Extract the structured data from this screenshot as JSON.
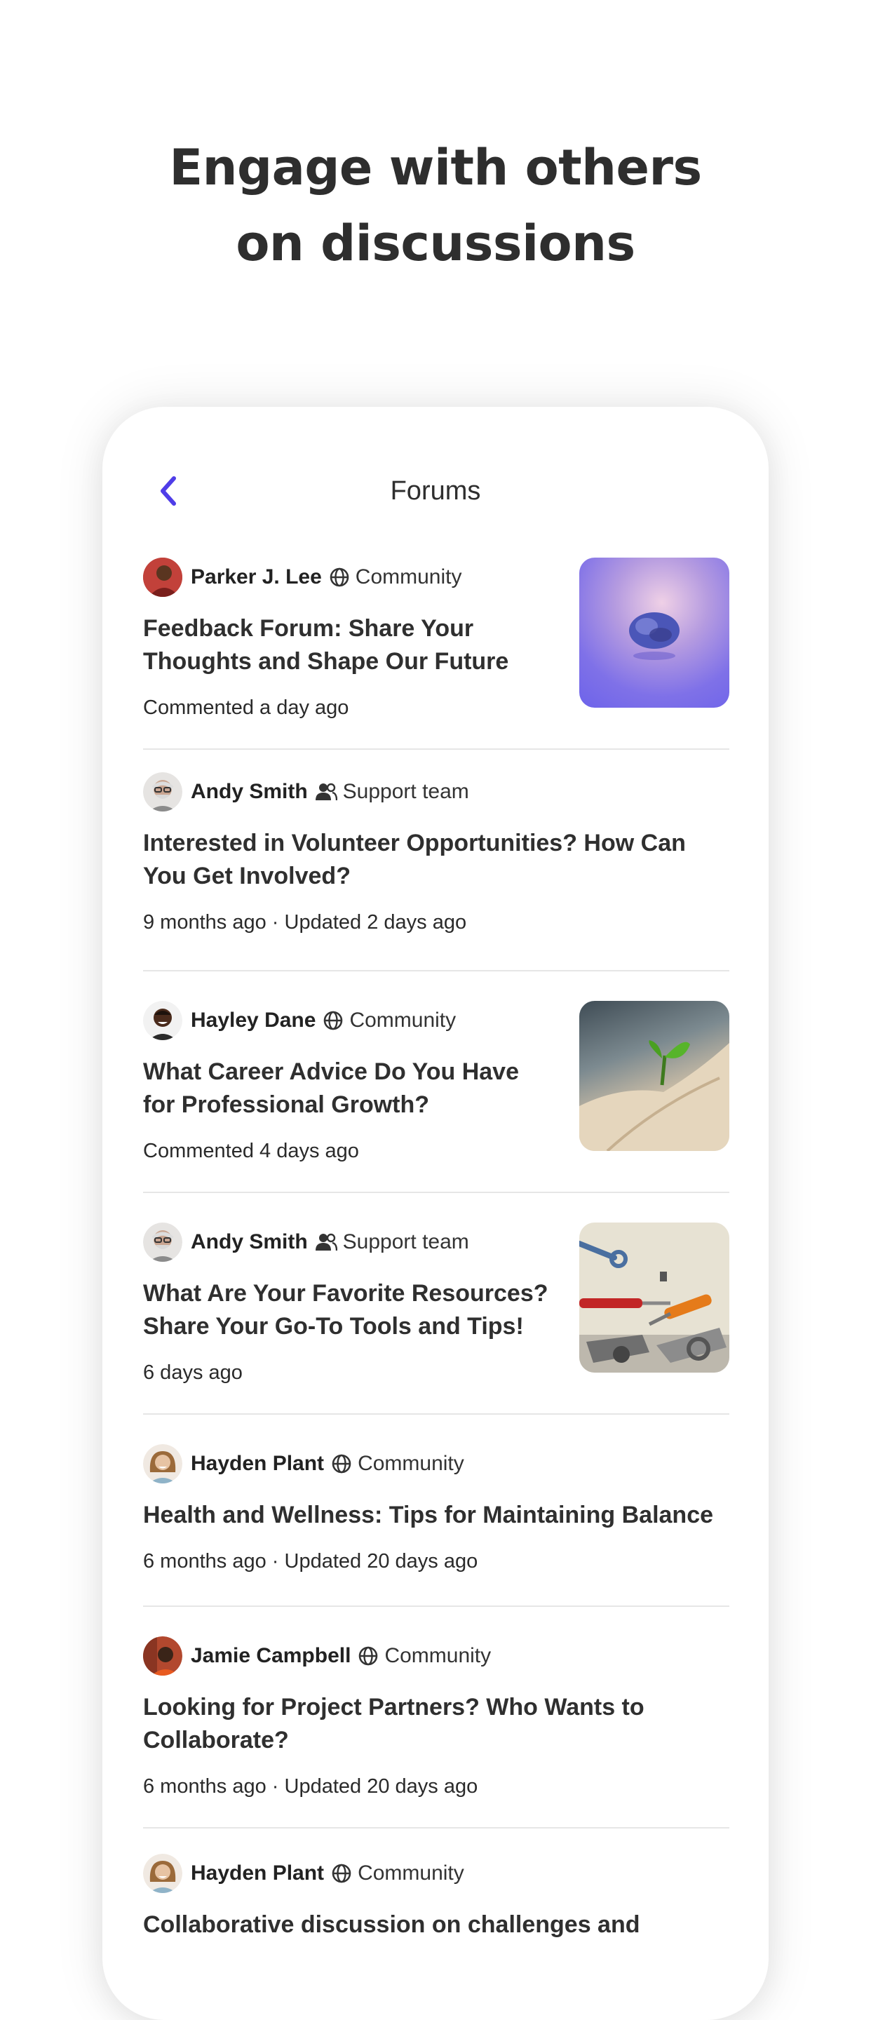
{
  "hero": {
    "line1": "Engage with others",
    "line2": "on discussions"
  },
  "screen": {
    "title": "Forums",
    "back_icon": "chevron-left-icon",
    "accent_color": "#4f3de8"
  },
  "posts": [
    {
      "author": "Parker J. Lee",
      "role": "Community",
      "role_icon": "globe-icon",
      "title": "Feedback Forum: Share Your Thoughts and Shape Our Future",
      "subtitle": "Commented a day ago",
      "thumbnail": "brain-image"
    },
    {
      "author": "Andy Smith",
      "role": "Support team",
      "role_icon": "users-icon",
      "title": "Interested in Volunteer Opportunities? How Can You Get Involved?",
      "subtitle": "9 months ago · Updated 2 days ago"
    },
    {
      "author": "Hayley Dane",
      "role": "Community",
      "role_icon": "globe-icon",
      "title": "What Career Advice Do You Have for Professional Growth?",
      "subtitle": "Commented 4 days ago",
      "thumbnail": "sprout-in-hand-image"
    },
    {
      "author": "Andy Smith",
      "role": "Support team",
      "role_icon": "users-icon",
      "title": "What Are Your Favorite Resources? Share Your Go-To Tools and Tips!",
      "subtitle": "6 days ago",
      "thumbnail": "tools-image"
    },
    {
      "author": "Hayden Plant",
      "role": "Community",
      "role_icon": "globe-icon",
      "title": "Health and Wellness: Tips for Maintaining Balance",
      "subtitle": "6 months ago · Updated 20 days ago"
    },
    {
      "author": "Jamie Campbell",
      "role": "Community",
      "role_icon": "globe-icon",
      "title": "Looking for Project Partners? Who Wants to Collaborate?",
      "subtitle": "6 months ago · Updated 20 days ago"
    },
    {
      "author": "Hayden Plant",
      "role": "Community",
      "role_icon": "globe-icon",
      "title": "Collaborative discussion on challenges and",
      "subtitle": ""
    }
  ]
}
